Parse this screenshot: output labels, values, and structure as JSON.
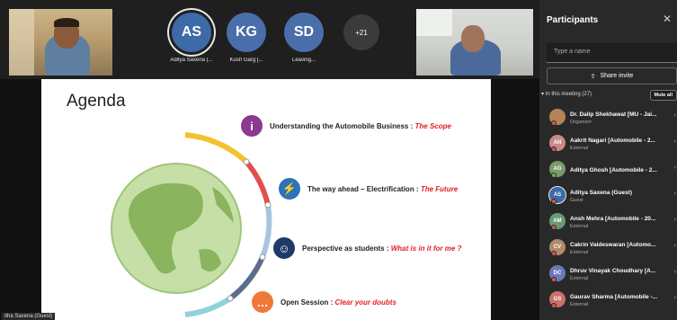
{
  "gallery": {
    "tiles": [
      {
        "initials": "AS",
        "name": "Aditya Saxena (...",
        "color": "#3d6aa8",
        "active": true
      },
      {
        "initials": "KG",
        "name": "Kush Garg [...",
        "color": "#4a6ea9",
        "active": false
      },
      {
        "initials": "SD",
        "name": "Leaving...",
        "color": "#4a6ea9",
        "active": false
      }
    ],
    "more_count": "+21"
  },
  "slide": {
    "title": "Agenda",
    "items": [
      {
        "label": "Understanding the Automobile Business : ",
        "emphasis": "The Scope",
        "icon": "info-icon",
        "color": "#8b3a8f"
      },
      {
        "label": "The way ahead – Electrification : ",
        "emphasis": "The Future",
        "icon": "electric-icon",
        "color": "#2c73b8"
      },
      {
        "label": "Perspective as students : ",
        "emphasis": "What is in it for me ?",
        "icon": "people-icon",
        "color": "#1f3a66"
      },
      {
        "label": "Open Session : ",
        "emphasis": "Clear your doubts",
        "icon": "chat-icon",
        "color": "#f0793a"
      }
    ],
    "presenter_label": "itha Saxena (Guest)"
  },
  "panel": {
    "title": "Participants",
    "name_placeholder": "Type a name",
    "share_invite": "Share invite",
    "in_meeting": "In this meeting (27)",
    "mute_all": "Mute all",
    "participants": [
      {
        "initials": "",
        "name": "Dr. Dalip Shekhawat [MU - Jai...",
        "role": "Organizer",
        "color": "#b5835a",
        "status": "#d9534f",
        "photo": true
      },
      {
        "initials": "AN",
        "name": "Aakrit Nagari [Automobile - 2...",
        "role": "External",
        "color": "#c98a8a",
        "status": "#d9534f",
        "photo": false
      },
      {
        "initials": "AG",
        "name": "Aditya Ghosh [Automobile - 2...",
        "role": "",
        "color": "#7a9a6a",
        "status": "#6bb34a",
        "photo": false
      },
      {
        "initials": "AS",
        "name": "Aditya Saxena (Guest)",
        "role": "Guest",
        "color": "#3d6aa8",
        "status": "#d9534f",
        "photo": false
      },
      {
        "initials": "AM",
        "name": "Ansh Mehra [Automobile - 20...",
        "role": "External",
        "color": "#6a9a72",
        "status": "#d9534f",
        "photo": false
      },
      {
        "initials": "CV",
        "name": "Cakrin Vaideswaran [Automo...",
        "role": "External",
        "color": "#b08a6a",
        "status": "#d9534f",
        "photo": false
      },
      {
        "initials": "DC",
        "name": "Dhruv Vinayak Choudhary [A...",
        "role": "External",
        "color": "#6a7ab8",
        "status": "#d9534f",
        "photo": false
      },
      {
        "initials": "GS",
        "name": "Gaurav Sharma [Automobile -...",
        "role": "External",
        "color": "#c9706a",
        "status": "#d9534f",
        "photo": false
      }
    ]
  }
}
